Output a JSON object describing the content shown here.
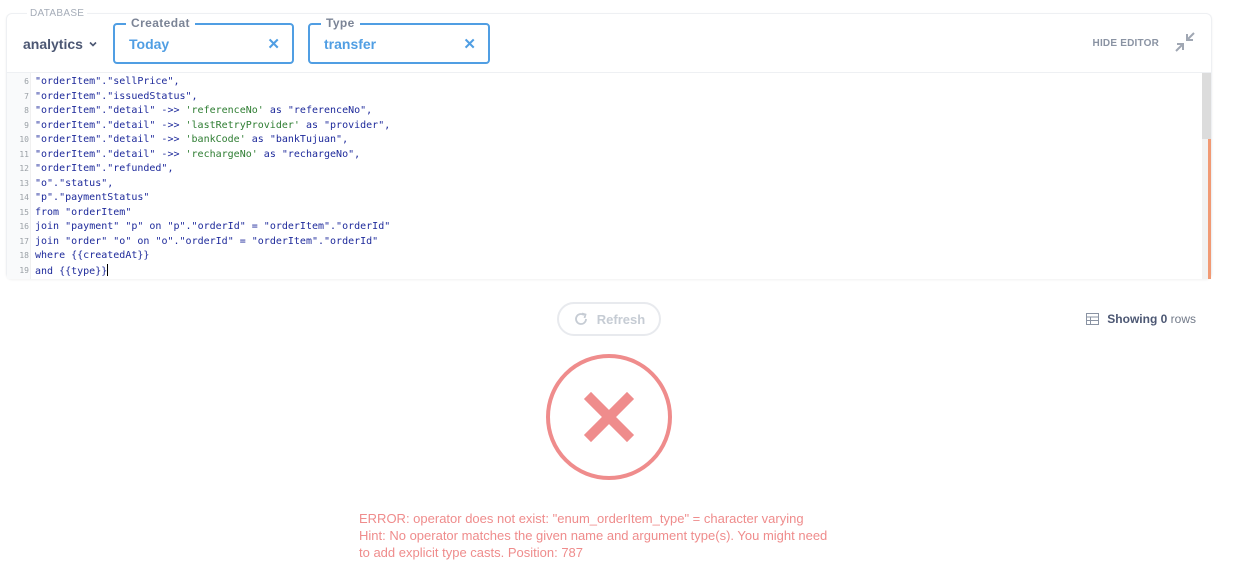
{
  "toolbar": {
    "database_caption": "DATABASE",
    "database_name": "analytics",
    "hide_editor_label": "HIDE EDITOR",
    "filters": [
      {
        "label": "Createdat",
        "value": "Today"
      },
      {
        "label": "Type",
        "value": "transfer"
      }
    ]
  },
  "editor": {
    "lines": [
      {
        "n": "6",
        "text": "\"orderItem\".\"sellPrice\","
      },
      {
        "n": "7",
        "text": "\"orderItem\".\"issuedStatus\","
      },
      {
        "n": "8",
        "text": "\"orderItem\".\"detail\" ->> 'referenceNo' as \"referenceNo\","
      },
      {
        "n": "9",
        "text": "\"orderItem\".\"detail\" ->> 'lastRetryProvider' as \"provider\","
      },
      {
        "n": "10",
        "text": "\"orderItem\".\"detail\" ->> 'bankCode' as \"bankTujuan\","
      },
      {
        "n": "11",
        "text": "\"orderItem\".\"detail\" ->> 'rechargeNo' as \"rechargeNo\","
      },
      {
        "n": "12",
        "text": "\"orderItem\".\"refunded\","
      },
      {
        "n": "13",
        "text": "\"o\".\"status\","
      },
      {
        "n": "14",
        "text": "\"p\".\"paymentStatus\""
      },
      {
        "n": "15",
        "text": "from \"orderItem\""
      },
      {
        "n": "16",
        "text": "join \"payment\" \"p\" on \"p\".\"orderId\" = \"orderItem\".\"orderId\""
      },
      {
        "n": "17",
        "text": "join \"order\" \"o\" on \"o\".\"orderId\" = \"orderItem\".\"orderId\""
      },
      {
        "n": "18",
        "text": "where {{createdAt}}"
      },
      {
        "n": "19",
        "text": "and {{type}}"
      }
    ]
  },
  "refresh_label": "Refresh",
  "result": {
    "showing_prefix": "Showing",
    "row_count": "0",
    "rows_suffix": "rows"
  },
  "error": {
    "line1": "ERROR: operator does not exist: \"enum_orderItem_type\" = character varying",
    "line2": "Hint: No operator matches the given name and argument type(s). You might need",
    "line3": "to add explicit type casts. Position: 787"
  },
  "colors": {
    "brand_blue": "#509ee3",
    "error_red": "#ef8c8c",
    "accent_orange": "#f19a74"
  },
  "icons": [
    "chevron-down-icon",
    "clear-icon",
    "collapse-icon",
    "refresh-icon",
    "table-icon",
    "error-x-icon"
  ]
}
